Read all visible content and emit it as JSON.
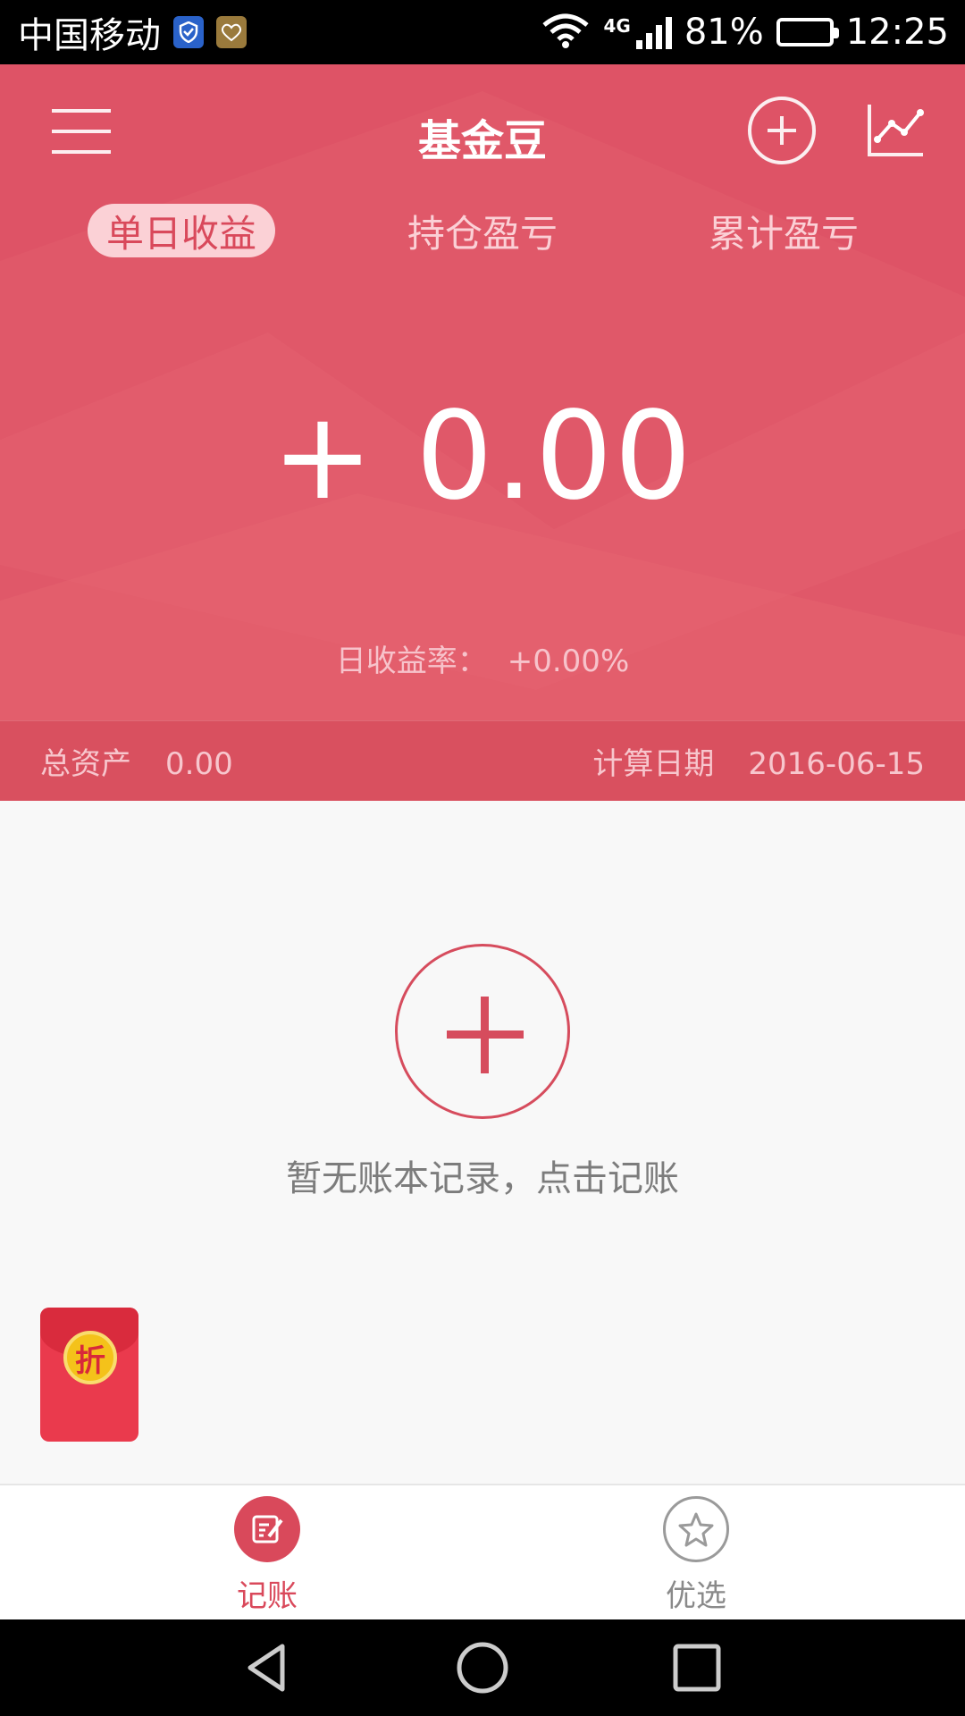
{
  "status_bar": {
    "carrier": "中国移动",
    "network": "4G",
    "battery": "81%",
    "battery_level": 0.81,
    "time": "12:25",
    "icons": [
      "shield-icon",
      "health-app-icon",
      "wifi-icon",
      "signal-icon",
      "battery-icon"
    ]
  },
  "header": {
    "title": "基金豆",
    "add_icon": "plus-circle-icon",
    "chart_icon": "line-chart-icon",
    "menu_icon": "menu-icon"
  },
  "tabs": [
    {
      "label": "单日收益",
      "active": true
    },
    {
      "label": "持仓盈亏",
      "active": false
    },
    {
      "label": "累计盈亏",
      "active": false
    }
  ],
  "summary": {
    "value": "+ 0.00",
    "rate_label": "日收益率：",
    "rate_value": "+0.00%"
  },
  "asset_bar": {
    "total_label": "总资产",
    "total_value": "0.00",
    "date_label": "计算日期",
    "date_value": "2016-06-15"
  },
  "empty_state": {
    "text": "暂无账本记录，点击记账",
    "icon": "add-record-icon"
  },
  "promo": {
    "badge": "折",
    "icon": "red-packet-icon"
  },
  "bottom_nav": [
    {
      "label": "记账",
      "icon": "notebook-edit-icon",
      "active": true
    },
    {
      "label": "优选",
      "icon": "star-icon",
      "active": false
    }
  ],
  "colors": {
    "accent": "#d9495b",
    "header_bg": "#e05869",
    "asset_bar_bg": "#d9505f"
  }
}
